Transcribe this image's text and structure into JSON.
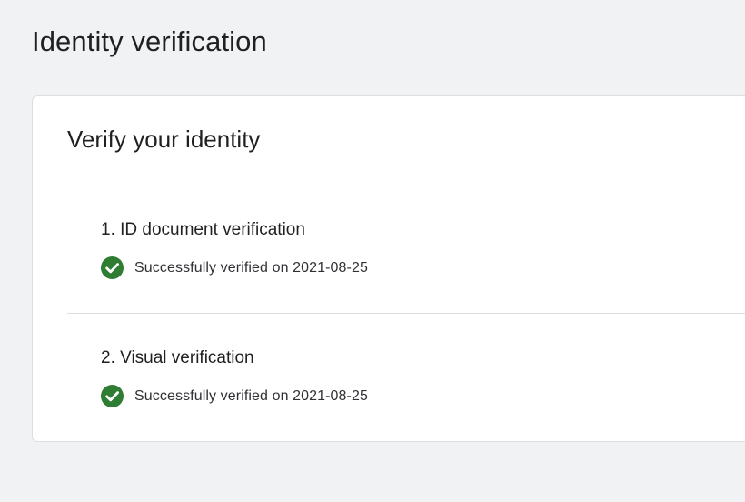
{
  "page": {
    "title": "Identity verification"
  },
  "card": {
    "title": "Verify your identity",
    "steps": [
      {
        "label": "1. ID document verification",
        "status_text": "Successfully verified on 2021-08-25",
        "status_icon": "check-circle-icon"
      },
      {
        "label": "2. Visual verification",
        "status_text": "Successfully verified on 2021-08-25",
        "status_icon": "check-circle-icon"
      }
    ]
  },
  "colors": {
    "background": "#f1f2f4",
    "card_background": "#ffffff",
    "divider": "#dcdee2",
    "success": "#2e7d32",
    "text_primary": "#1f2022"
  }
}
